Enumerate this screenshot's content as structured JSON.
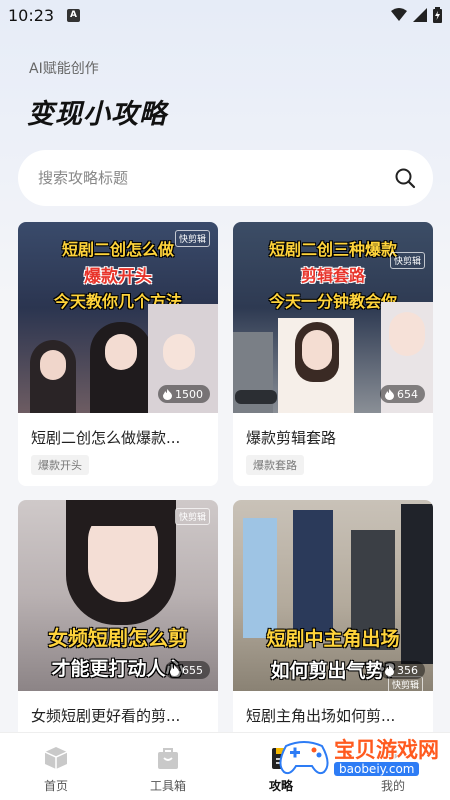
{
  "status": {
    "time": "10:23",
    "notif": "A"
  },
  "header": {
    "subtitle": "AI赋能创作",
    "title": "变现小攻略"
  },
  "search": {
    "placeholder": "搜索攻略标题"
  },
  "cards": [
    {
      "title": "短剧二创怎么做爆款...",
      "tag": "爆款开头",
      "count": "1500",
      "overlay": [
        "短剧二创怎么做",
        "爆款开头",
        "今天教你几个方法"
      ],
      "logo": "快剪辑"
    },
    {
      "title": "爆款剪辑套路",
      "tag": "爆款套路",
      "count": "654",
      "overlay": [
        "短剧二创三种爆款",
        "剪辑套路",
        "今天一分钟教会你"
      ],
      "logo": "快剪辑"
    },
    {
      "title": "女频短剧更好看的剪...",
      "tag": "",
      "count": "655",
      "overlay": [
        "女频短剧怎么剪",
        "才能更打动人心"
      ],
      "logo": "快剪辑"
    },
    {
      "title": "短剧主角出场如何剪...",
      "tag": "",
      "count": "356",
      "overlay": [
        "短剧中主角出场",
        "如何剪出气势?"
      ],
      "logo": "快剪辑"
    }
  ],
  "tabs": [
    {
      "label": "首页",
      "icon": "box-icon"
    },
    {
      "label": "工具箱",
      "icon": "toolbox-icon"
    },
    {
      "label": "攻略",
      "icon": "book-icon"
    },
    {
      "label": "我的",
      "icon": "profile-icon"
    }
  ],
  "watermark": {
    "name": "宝贝游戏网",
    "url": "baobeiy.com"
  },
  "colors": {
    "accent_text": "#ffd43b",
    "overlay_red": "#e8342b",
    "watermark_orange": "#ff5a1f",
    "watermark_blue": "#2d7cf5"
  }
}
